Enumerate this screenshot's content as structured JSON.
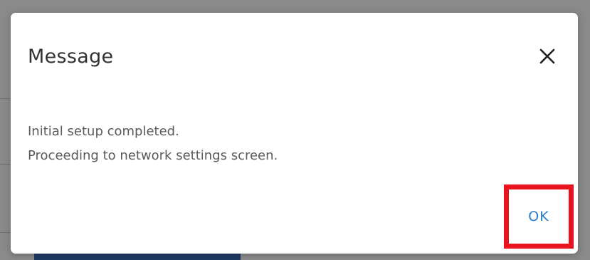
{
  "dialog": {
    "title": "Message",
    "close_icon": "close-icon",
    "body_lines": [
      "Initial setup completed.",
      "Proceeding to network settings screen."
    ],
    "ok_label": "OK"
  },
  "colors": {
    "overlay": "#8a8a8a",
    "dialog_background": "#ffffff",
    "title_text": "#333333",
    "body_text": "#5a5a5a",
    "ok_text": "#2a7bc6",
    "highlight_border": "#e8131f"
  }
}
